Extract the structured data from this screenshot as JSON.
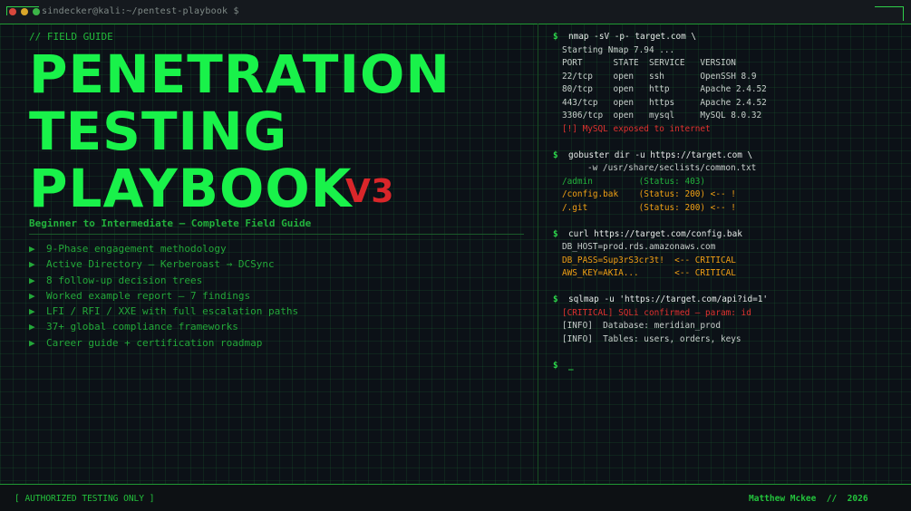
{
  "window": {
    "title": "sindecker@kali:~/pentest-playbook $"
  },
  "cover": {
    "eyebrow": "// FIELD GUIDE",
    "title_line1": "PENETRATION",
    "title_line2": "TESTING",
    "title_line3": "PLAYBOOK",
    "version": "V3",
    "subtitle": "Beginner to Intermediate — Complete Field Guide",
    "bullet_symbol": "▶",
    "features": [
      "9-Phase engagement methodology",
      "Active Directory  —  Kerberoast → DCSync",
      "8 follow-up decision trees",
      "Worked example report — 7 findings",
      "LFI / RFI / XXE with full escalation paths",
      "37+ global compliance frameworks",
      "Career guide + certification roadmap"
    ]
  },
  "terminal": {
    "prompt": "$",
    "nmap_cmd": "nmap -sV -p- target.com \\",
    "nmap_lines": [
      "Starting Nmap 7.94 ...",
      "PORT      STATE  SERVICE   VERSION",
      "22/tcp    open   ssh       OpenSSH 8.9",
      "80/tcp    open   http      Apache 2.4.52",
      "443/tcp   open   https     Apache 2.4.52",
      "3306/tcp  open   mysql     MySQL 8.0.32"
    ],
    "nmap_alert": "[!] MySQL exposed to internet",
    "gobuster_cmd": "gobuster dir -u https://target.com \\",
    "gobuster_cmd2": "-w /usr/share/seclists/common.txt",
    "gobuster_admin": "/admin         (Status: 403)",
    "gobuster_config": "/config.bak    (Status: 200) <-- !",
    "gobuster_git": "/.git          (Status: 200) <-- !",
    "curl_cmd": "curl https://target.com/config.bak",
    "curl_host": "DB_HOST=prod.rds.amazonaws.com",
    "curl_pass": "DB_PASS=Sup3rS3cr3t!  <-- CRITICAL",
    "curl_key": "AWS_KEY=AKIA...       <-- CRITICAL",
    "sqlmap_cmd": "sqlmap -u 'https://target.com/api?id=1'",
    "sqlmap_critical": "[CRITICAL] SQLi confirmed — param: id",
    "sqlmap_info1": "[INFO]  Database: meridian_prod",
    "sqlmap_info2": "[INFO]  Tables: users, orders, keys",
    "cursor": "_"
  },
  "footer": {
    "left": "[ AUTHORIZED TESTING ONLY ]",
    "right": "Matthew Mckee  //  2026"
  },
  "colors": {
    "accent_green": "#19f24a",
    "alert_red": "#e0322f",
    "warning_orange": "#f0a014",
    "background": "#0c1117"
  }
}
